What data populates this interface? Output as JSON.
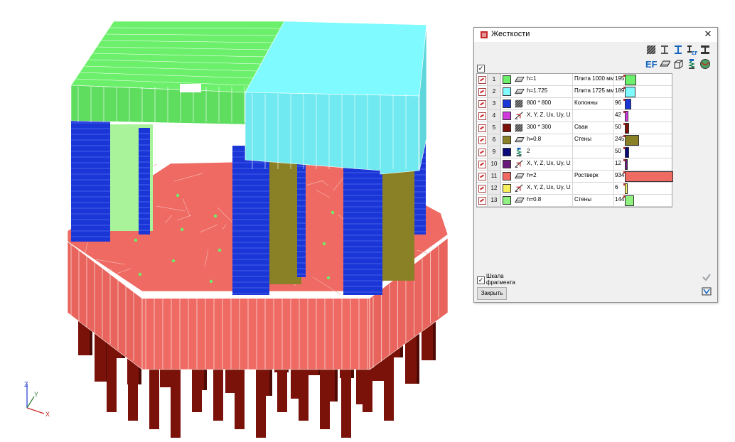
{
  "dialog": {
    "title": "Жесткости",
    "close_label": "Закрыть",
    "scale_label": "Шкала фрагмента",
    "scale_checked": true
  },
  "colors": {
    "slab1000": "#6cf06c",
    "slab1725": "#7ffbff",
    "columns": "#1a36d6",
    "raft": "#ee6a62",
    "piles": "#7a120a",
    "walls": "#8a8126",
    "grid": "#ffffff"
  },
  "axes": {
    "x": "X",
    "y": "Y",
    "z": "Z"
  },
  "toolbar": {
    "row1": [
      "hatched-section-icon",
      "i-beam-icon",
      "i-beam-alt-icon",
      "ef-beam-icon",
      "beam-stack-icon"
    ],
    "row2": [
      "ef-text-icon",
      "plate-icon",
      "solid-icon",
      "spring-icon",
      "sphere-icon"
    ],
    "ef_text": "EF"
  },
  "rows": [
    {
      "num": "1",
      "color": "#6cf06c",
      "icon": "plate-icon",
      "param": "h=1",
      "name": "Плита 1000 мм",
      "count": "195",
      "bar": 0.21
    },
    {
      "num": "2",
      "color": "#7ffbff",
      "icon": "plate-icon",
      "param": "h=1.725",
      "name": "Плита 1725 мм",
      "count": "189",
      "bar": 0.2
    },
    {
      "num": "3",
      "color": "#1a36d6",
      "icon": "hatched-section-icon",
      "param": "800 * 800",
      "name": "Колонны",
      "count": "96",
      "bar": 0.1
    },
    {
      "num": "4",
      "color": "#d03cdc",
      "icon": "connector-icon",
      "param": "X, Y, Z, Ux, Uy, Uz",
      "name": "",
      "count": "42",
      "bar": 0.045
    },
    {
      "num": "5",
      "color": "#7a120a",
      "icon": "hatched-section-icon",
      "param": "300 * 300",
      "name": "Сваи",
      "count": "50",
      "bar": 0.055
    },
    {
      "num": "6",
      "color": "#8a8126",
      "icon": "plate-icon",
      "param": "h=0.8",
      "name": "Стены",
      "count": "245",
      "bar": 0.27
    },
    {
      "num": "9",
      "color": "#0a0a7a",
      "icon": "spring-icon",
      "param": "2",
      "name": "",
      "count": "50",
      "bar": 0.055
    },
    {
      "num": "10",
      "color": "#6a1a7a",
      "icon": "connector-icon",
      "param": "X, Y, Z, Ux, Uy, Uz",
      "name": "",
      "count": "12",
      "bar": 0.013
    },
    {
      "num": "11",
      "color": "#ee6a62",
      "icon": "plate-icon",
      "param": "h=2",
      "name": "Ростверк",
      "count": "934",
      "bar": 1.0
    },
    {
      "num": "12",
      "color": "#f8f05a",
      "icon": "connector-icon",
      "param": "X, Y, Z, Ux, Uy, Uz",
      "name": "",
      "count": "6",
      "bar": 0.007
    },
    {
      "num": "13",
      "color": "#90f080",
      "icon": "plate-icon",
      "param": "h=0.8",
      "name": "Стены",
      "count": "144",
      "bar": 0.16
    }
  ]
}
